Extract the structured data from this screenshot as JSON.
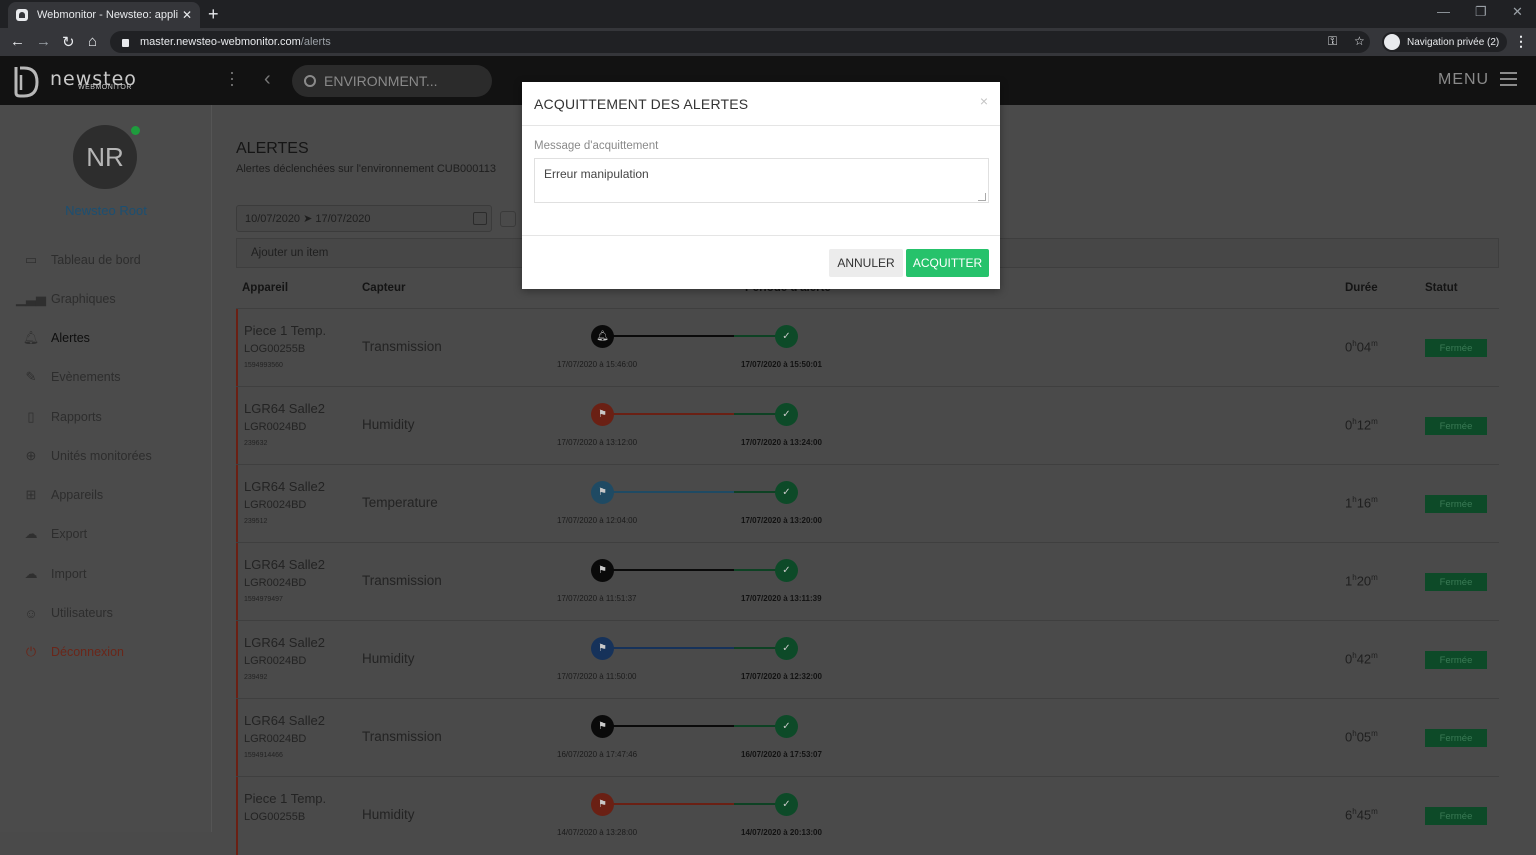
{
  "browser": {
    "tab_title": "Webmonitor - Newsteo: applicat",
    "tab_close": "✕",
    "new_tab": "+",
    "url_host": "master.newsteo-webmonitor.com",
    "url_path": "/alerts",
    "incognito_label": "Navigation privée (2)"
  },
  "header": {
    "brand": "newsteo",
    "brand_sub": "WEBMONITOR",
    "environment": "ENVIRONMENT...",
    "menu_label": "MENU"
  },
  "sidebar": {
    "initials": "NR",
    "user_name": "Newsteo Root",
    "items": [
      {
        "label": "Tableau de bord",
        "icon": "monitor-icon"
      },
      {
        "label": "Graphiques",
        "icon": "bar-chart-icon"
      },
      {
        "label": "Alertes",
        "icon": "bell-icon"
      },
      {
        "label": "Evènements",
        "icon": "pencil-icon"
      },
      {
        "label": "Rapports",
        "icon": "report-icon"
      },
      {
        "label": "Unités monitorées",
        "icon": "crosshair-icon"
      },
      {
        "label": "Appareils",
        "icon": "grid-icon"
      },
      {
        "label": "Export",
        "icon": "cloud-upload-icon"
      },
      {
        "label": "Import",
        "icon": "cloud-download-icon"
      },
      {
        "label": "Utilisateurs",
        "icon": "user-icon"
      },
      {
        "label": "Déconnexion",
        "icon": "power-icon"
      }
    ]
  },
  "page": {
    "title": "ALERTES",
    "subtitle": "Alertes déclenchées sur l'environnement CUB000113",
    "date_range": "10/07/2020 ➤ 17/07/2020",
    "add_item": "Ajouter un item",
    "columns": {
      "device": "Appareil",
      "sensor": "Capteur",
      "period": "Période d'alerte",
      "duration": "Durée",
      "status": "Statut"
    }
  },
  "alerts": [
    {
      "device": "Piece 1 Temp.",
      "serial": "LOG00255B",
      "id": "1594993560",
      "sensor": "Transmission",
      "start": "17/07/2020 à 15:46:00",
      "end": "17/07/2020 à 15:50:01",
      "dur_h": "0",
      "dur_m": "04",
      "status": "Fermée",
      "start_icon": "bell-icon",
      "start_color": "#0a0a0a",
      "line_color": "#0a0a0a"
    },
    {
      "device": "LGR64 Salle2",
      "serial": "LGR0024BD",
      "id": "239632",
      "sensor": "Humidity",
      "start": "17/07/2020 à 13:12:00",
      "end": "17/07/2020 à 13:24:00",
      "dur_h": "0",
      "dur_m": "12",
      "status": "Fermée",
      "start_icon": "flag-icon",
      "start_color": "#6a2014",
      "line_color": "#6a2014"
    },
    {
      "device": "LGR64 Salle2",
      "serial": "LGR0024BD",
      "id": "239512",
      "sensor": "Temperature",
      "start": "17/07/2020 à 12:04:00",
      "end": "17/07/2020 à 13:20:00",
      "dur_h": "1",
      "dur_m": "16",
      "status": "Fermée",
      "start_icon": "flag-icon",
      "start_color": "#1f4a63",
      "line_color": "#1f4a63"
    },
    {
      "device": "LGR64 Salle2",
      "serial": "LGR0024BD",
      "id": "1594979497",
      "sensor": "Transmission",
      "start": "17/07/2020 à 11:51:37",
      "end": "17/07/2020 à 13:11:39",
      "dur_h": "1",
      "dur_m": "20",
      "status": "Fermée",
      "start_icon": "flag-icon",
      "start_color": "#0a0a0a",
      "line_color": "#0a0a0a"
    },
    {
      "device": "LGR64 Salle2",
      "serial": "LGR0024BD",
      "id": "239492",
      "sensor": "Humidity",
      "start": "17/07/2020 à 11:50:00",
      "end": "17/07/2020 à 12:32:00",
      "dur_h": "0",
      "dur_m": "42",
      "status": "Fermée",
      "start_icon": "flag-icon",
      "start_color": "#16325a",
      "line_color": "#16325a"
    },
    {
      "device": "LGR64 Salle2",
      "serial": "LGR0024BD",
      "id": "1594914466",
      "sensor": "Transmission",
      "start": "16/07/2020 à 17:47:46",
      "end": "16/07/2020 à 17:53:07",
      "dur_h": "0",
      "dur_m": "05",
      "status": "Fermée",
      "start_icon": "flag-icon",
      "start_color": "#0a0a0a",
      "line_color": "#0a0a0a"
    },
    {
      "device": "Piece 1 Temp.",
      "serial": "LOG00255B",
      "id": "",
      "sensor": "Humidity",
      "start": "14/07/2020 à 13:28:00",
      "end": "14/07/2020 à 20:13:00",
      "dur_h": "6",
      "dur_m": "45",
      "status": "Fermée",
      "start_icon": "flag-icon",
      "start_color": "#6a2014",
      "line_color": "#6a2014"
    }
  ],
  "modal": {
    "title": "ACQUITTEMENT DES ALERTES",
    "close": "×",
    "message_label": "Message d'acquittement",
    "message_value": "Erreur manipulation",
    "cancel": "ANNULER",
    "confirm": "ACQUITTER",
    "confirm_color": "#26c26b"
  }
}
